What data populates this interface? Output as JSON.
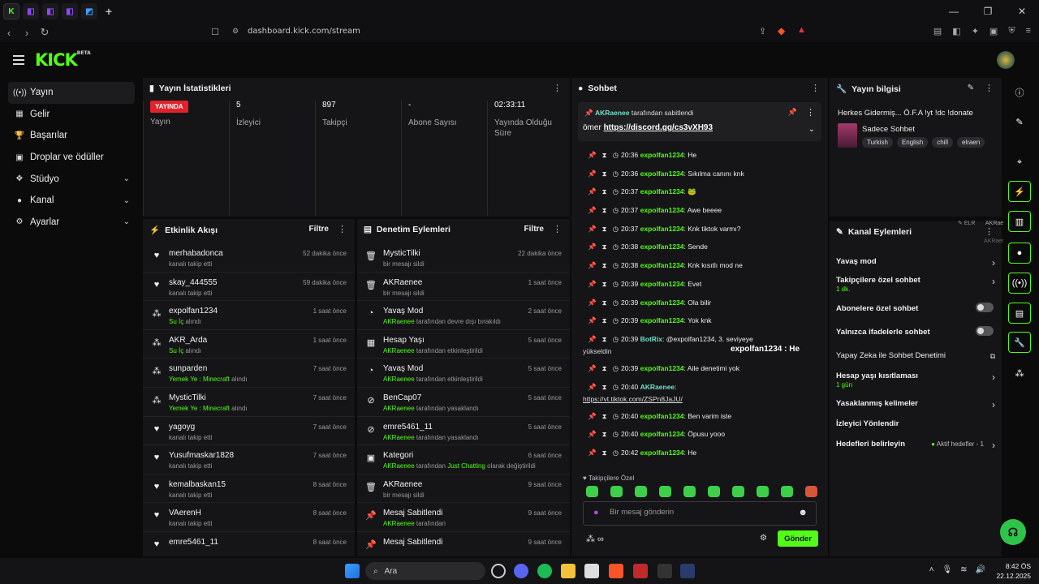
{
  "browser": {
    "url": "dashboard.kick.com/stream",
    "new_tab": "+",
    "win_min": "—",
    "win_max": "❐",
    "win_close": "✕"
  },
  "header": {
    "logo": "KICK",
    "logo_badge": "BETA"
  },
  "sidebar": {
    "items": [
      {
        "label": "Yayın",
        "icon": "((•))"
      },
      {
        "label": "Gelir",
        "icon": "▦"
      },
      {
        "label": "Başarılar",
        "icon": "🏆"
      },
      {
        "label": "Droplar ve ödüller",
        "icon": "▣"
      },
      {
        "label": "Stüdyo",
        "icon": "✥"
      },
      {
        "label": "Kanal",
        "icon": "●"
      },
      {
        "label": "Ayarlar",
        "icon": "⚙"
      }
    ]
  },
  "stats": {
    "title": "Yayın İstatistikleri",
    "live_badge": "YAYINDA",
    "live_label": "Yayın",
    "viewers_value": "5",
    "viewers_label": "İzleyici",
    "followers_value": "897",
    "followers_label": "Takipçi",
    "subs_value": "-",
    "subs_label": "Abone Sayısı",
    "duration_value": "02:33:11",
    "duration_label": "Yayında Olduğu Süre"
  },
  "events": {
    "title": "Etkinlik Akışı",
    "filter": "Filtre",
    "rows": [
      {
        "name": "merhabadonca",
        "sub": "kanalı takip etti",
        "time": "52 dakika önce",
        "icon": "♥"
      },
      {
        "name": "skay_444555",
        "sub": "kanalı takip etti",
        "time": "59 dakika önce",
        "icon": "♥"
      },
      {
        "name": "expolfan1234",
        "sub_hl": "Su İç",
        "sub": " alındı",
        "time": "1 saat önce",
        "icon": "⁂"
      },
      {
        "name": "AKR_Arda",
        "sub_hl": "Su İç",
        "sub": " alındı",
        "time": "1 saat önce",
        "icon": "⁂"
      },
      {
        "name": "sunparden",
        "sub_hl": "Yemek Ye : Minecraft",
        "sub": " alındı",
        "time": "7 saat önce",
        "icon": "⁂"
      },
      {
        "name": "MysticTilki",
        "sub_hl": "Yemek Ye : Minecraft",
        "sub": " alındı",
        "time": "7 saat önce",
        "icon": "⁂"
      },
      {
        "name": "yagoyg",
        "sub": "kanalı takip etti",
        "time": "7 saat önce",
        "icon": "♥"
      },
      {
        "name": "Yusufmaskar1828",
        "sub": "kanalı takip etti",
        "time": "7 saat önce",
        "icon": "♥"
      },
      {
        "name": "kemalbaskan15",
        "sub": "kanalı takip etti",
        "time": "8 saat önce",
        "icon": "♥"
      },
      {
        "name": "VAerenH",
        "sub": "kanalı takip etti",
        "time": "8 saat önce",
        "icon": "♥"
      },
      {
        "name": "emre5461_11",
        "sub": "",
        "time": "8 saat önce",
        "icon": "♥"
      }
    ]
  },
  "mod": {
    "title": "Denetim Eylemleri",
    "filter": "Filtre",
    "rows": [
      {
        "name": "MysticTilki",
        "sub_hl": "",
        "sub": "bir mesajı sildi",
        "time": "22 dakika önce",
        "icon": "🗑"
      },
      {
        "name": "AKRaenee",
        "sub_hl": "",
        "sub": "bir mesajı sildi",
        "time": "1 saat önce",
        "icon": "🗑"
      },
      {
        "name": "Yavaş Mod",
        "sub_hl": "AKRaenee",
        "sub": " tarafından devre dışı bırakıldı",
        "time": "2 saat önce",
        "icon": "◔"
      },
      {
        "name": "Hesap Yaşı",
        "sub_hl": "AKRaenee",
        "sub": " tarafından etkinleştirildi",
        "time": "5 saat önce",
        "icon": "▦"
      },
      {
        "name": "Yavaş Mod",
        "sub_hl": "AKRaenee",
        "sub": " tarafından etkinleştirildi",
        "time": "5 saat önce",
        "icon": "◔"
      },
      {
        "name": "BenCap07",
        "sub_hl": "AKRaenee",
        "sub": " tarafından yasaklandı",
        "time": "5 saat önce",
        "icon": "⊘"
      },
      {
        "name": "emre5461_11",
        "sub_hl": "AKRaenee",
        "sub": " tarafından yasaklandı",
        "time": "5 saat önce",
        "icon": "⊘"
      },
      {
        "name": "Kategori",
        "sub_hl": "AKRaenee",
        "sub": " tarafından ",
        "sub_hl2": "Just Chatting",
        "sub2": " olarak değiştirildi",
        "time": "6 saat önce",
        "icon": "▣"
      },
      {
        "name": "AKRaenee",
        "sub_hl": "",
        "sub": "bir mesajı sildi",
        "time": "9 saat önce",
        "icon": "🗑"
      },
      {
        "name": "Mesaj Sabitlendi",
        "sub_hl": "AKRaenee",
        "sub": " tarafından",
        "time": "9 saat önce",
        "icon": "📌"
      },
      {
        "name": "Mesaj Sabitlendi",
        "sub_hl": "",
        "sub": "",
        "time": "9 saat önce",
        "icon": "📌"
      }
    ]
  },
  "chat": {
    "title": "Sohbet",
    "pinned_by_user": "AKRaenee",
    "pinned_by_suffix": " tarafından sabitlendi",
    "pinned_user": "ömer",
    "pinned_link": "https://discord.gg/cs3vXH93",
    "messages": [
      {
        "time": "20:36",
        "user": "expolfan1234",
        "text": "He"
      },
      {
        "time": "20:36",
        "user": "expolfan1234",
        "text": "Sıkılma canını knk"
      },
      {
        "time": "20:37",
        "user": "expolfan1234",
        "text": "🐸"
      },
      {
        "time": "20:37",
        "user": "expolfan1234",
        "text": "Awe beeee"
      },
      {
        "time": "20:37",
        "user": "expolfan1234",
        "text": "Knk tiktok varmı?"
      },
      {
        "time": "20:38",
        "user": "expolfan1234",
        "text": "Sende"
      },
      {
        "time": "20:38",
        "user": "expolfan1234",
        "text": "Knk kısıtlı mod ne"
      },
      {
        "time": "20:39",
        "user": "expolfan1234",
        "text": "Evet"
      },
      {
        "time": "20:39",
        "user": "expolfan1234",
        "text": "Ola bilir"
      },
      {
        "time": "20:39",
        "user": "expolfan1234",
        "text": "Yok knk"
      }
    ],
    "botrix": {
      "time": "20:39",
      "user": "BotRix",
      "text": "@expolfan1234, 3. seviyeye",
      "wrap": "yükseldin",
      "popup": "expolfan1234 : He"
    },
    "after": [
      {
        "time": "20:39",
        "user": "expolfan1234",
        "text": "Aile denetimi yok"
      }
    ],
    "akr": {
      "time": "20:40",
      "user": "AKRaenee",
      "link": "https://vt.tiktok.com/ZSPn8JaJU/"
    },
    "tail": [
      {
        "time": "20:40",
        "user": "expolfan1234",
        "text": "Ben varim iste"
      },
      {
        "time": "20:40",
        "user": "expolfan1234",
        "text": "Öpusu yooo"
      },
      {
        "time": "20:42",
        "user": "expolfan1234",
        "text": "He"
      }
    ],
    "followers_only": "Takipçilere Özel",
    "input_placeholder": "Bir mesaj gönderin",
    "send": "Gönder"
  },
  "info": {
    "title": "Yayın bilgisi",
    "stream_title": "Herkes Gidermiş... Ö.F.A !yt !dc !donate",
    "category": "Sadece Sohbet",
    "tags": [
      "Turkish",
      "English",
      "chill",
      "elraen"
    ]
  },
  "channel_actions": {
    "title": "Kanal Eylemleri",
    "overlay_top": "ELR",
    "overlay_user": "AKRaenee",
    "overlay_user2": "AKRaene",
    "slow_mode": "Yavaş mod",
    "followers_chat": "Takipçilere özel sohbet",
    "followers_chat_sub": "1 dk.",
    "subs_chat": "Abonelere özel sohbet",
    "emotes_chat": "Yalnızca ifadelerle sohbet",
    "ai_mod": "Yapay Zeka ile Sohbet Denetimi",
    "account_age": "Hesap yaşı kısıtlaması",
    "account_age_sub": "1 gün",
    "banned_words": "Yasaklanmış kelimeler",
    "raid": "İzleyici Yönlendir",
    "goals": "Hedefleri belirleyin",
    "goals_status": "Aktif hedefler - 1"
  },
  "taskbar": {
    "search": "Ara",
    "time": "8:42 ÖS",
    "date": "22.12.2025"
  }
}
